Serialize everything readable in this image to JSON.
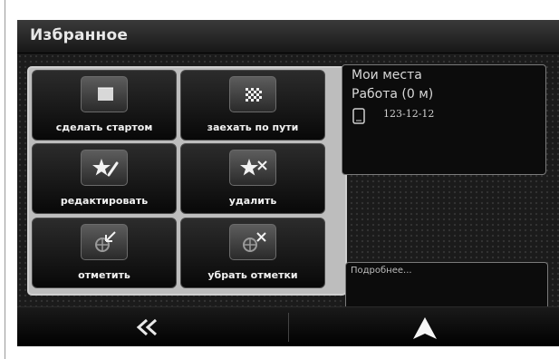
{
  "header": {
    "title": "Избранное"
  },
  "actions": [
    {
      "label": "сделать стартом",
      "icon": "flag-icon"
    },
    {
      "label": "заехать по пути",
      "icon": "checkered-flag-icon"
    },
    {
      "label": "редактировать",
      "icon": "star-edit-icon"
    },
    {
      "label": "удалить",
      "icon": "star-delete-icon"
    },
    {
      "label": "отметить",
      "icon": "mark-icon"
    },
    {
      "label": "убрать отметки",
      "icon": "unmark-icon"
    }
  ],
  "info": {
    "title": "Мои места",
    "subtitle": "Работа (0 м)",
    "phone": "123-12-12"
  },
  "details": {
    "label": "Подробнее..."
  },
  "bottom": {
    "back_icon": "double-chevron-left-icon",
    "navigate_icon": "navigation-arrow-icon"
  },
  "colors": {
    "background": "#111111",
    "text": "#f2f2f2",
    "panel_border": "#cfcfcf"
  }
}
